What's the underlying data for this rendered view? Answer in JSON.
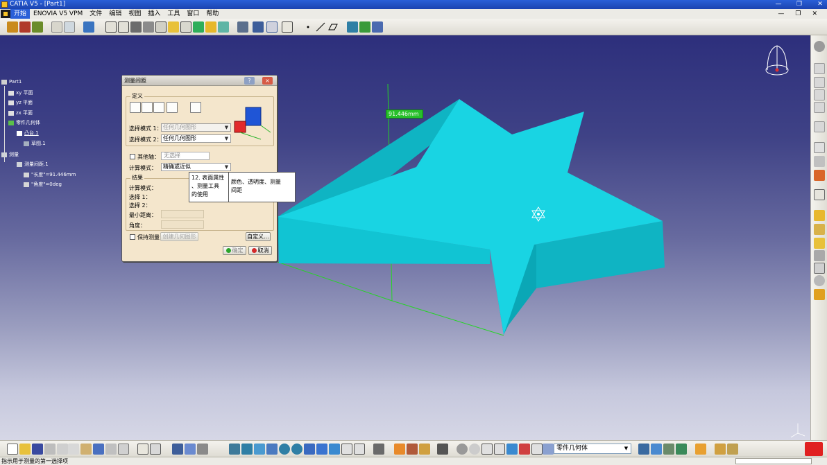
{
  "window": {
    "title": "CATIA V5 - [Part1]"
  },
  "menu": {
    "items": [
      "开始",
      "ENOVIA V5 VPM",
      "文件",
      "编辑",
      "视图",
      "插入",
      "工具",
      "窗口",
      "帮助"
    ],
    "active_index": 0
  },
  "spec_tree": {
    "root": "Part1",
    "planes": [
      "xy 平面",
      "yz 平面",
      "zx 平面"
    ],
    "body": "零件几何体",
    "pad": "凸台.1",
    "sketch": "草图.1",
    "measure_root": "测量",
    "measure_item": "测量间距.1",
    "length": "\"长度\"=91.446mm",
    "angle": "\"角度\"=0deg"
  },
  "dialog": {
    "title": "测量间距",
    "help_button": "?",
    "close_button": "×",
    "definition_group": "定义",
    "selection_mode_1_label": "选择模式 1：",
    "selection_mode_1_value": "任何几何图形",
    "selection_mode_2_label": "选择模式 2：",
    "selection_mode_2_value": "任何几何图形",
    "other_axis_label": "其他轴：",
    "other_axis_value": "无选择",
    "calc_mode_label": "计算模式：",
    "calc_mode_value": "精确或近似",
    "result_group": "结果",
    "result_calc_mode_label": "计算模式：",
    "result_sel1_label": "选择 1：",
    "result_sel2_label": "选择 2：",
    "min_distance_label": "最小距离：",
    "angle_label": "角度：",
    "keep_measure_label": "保持测量",
    "create_geometry_button": "创建几何图形",
    "customize_button": "自定义...",
    "ok_button": "确定",
    "cancel_button": "取消"
  },
  "tooltip": {
    "left_text": "12. 表面属性\n、测量工具\n的使用",
    "right_text": "颜色、透明度、测量\n间距"
  },
  "dimension": {
    "value": "91.446mm"
  },
  "bottom_toolbar": {
    "body_select_value": "零件几何体"
  },
  "statusbar": {
    "message": "指示用于测量的第一选择项"
  },
  "colors": {
    "background_top": "#2d2f7c",
    "background_bottom": "#d6d7e6",
    "star": "#19d4e3",
    "star_side": "#0fb4c3",
    "measure_line": "#26d426",
    "dialog": "#f4e6cc"
  },
  "icons": {
    "compass": "compass-icon",
    "catia_logo": "catia-logo-icon",
    "axis": "axis-icon"
  }
}
